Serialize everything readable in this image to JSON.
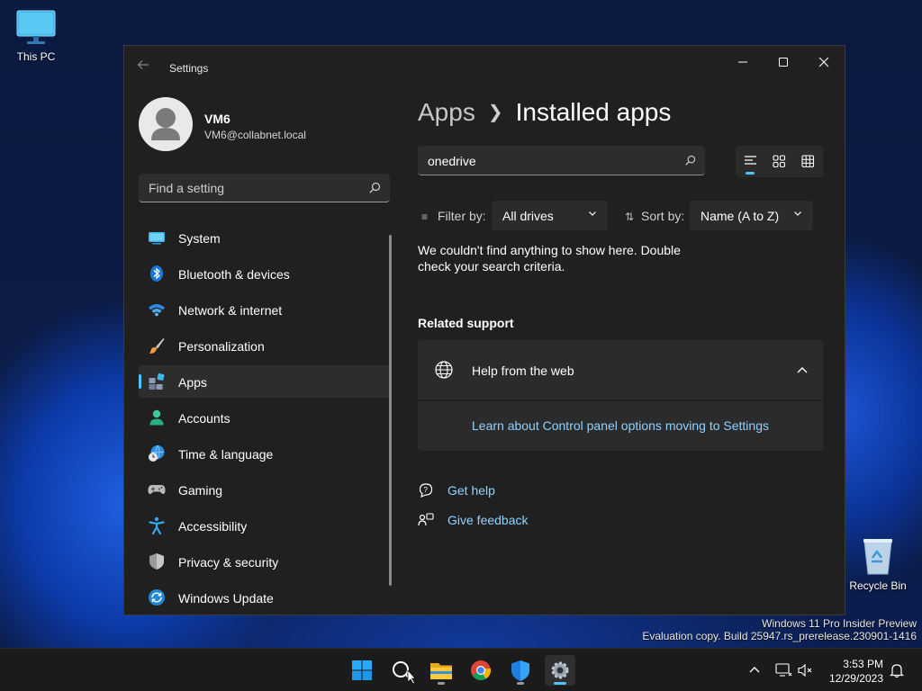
{
  "desktop": {
    "icons": [
      {
        "label": "This PC"
      },
      {
        "label": "Recycle Bin"
      }
    ],
    "watermark": {
      "line1": "Windows 11 Pro Insider Preview",
      "line2": "Evaluation copy. Build 25947.rs_prerelease.230901-1416"
    }
  },
  "window": {
    "title": "Settings",
    "back_icon": "back-arrow-icon",
    "controls": [
      "minimize",
      "maximize",
      "close"
    ]
  },
  "profile": {
    "name": "VM6",
    "email": "VM6@collabnet.local"
  },
  "find_setting": {
    "placeholder": "Find a setting"
  },
  "nav": {
    "items": [
      {
        "label": "System",
        "icon": "system-display-icon"
      },
      {
        "label": "Bluetooth & devices",
        "icon": "bluetooth-icon"
      },
      {
        "label": "Network & internet",
        "icon": "wifi-icon"
      },
      {
        "label": "Personalization",
        "icon": "paintbrush-icon"
      },
      {
        "label": "Apps",
        "icon": "apps-icon",
        "active": true
      },
      {
        "label": "Accounts",
        "icon": "person-icon"
      },
      {
        "label": "Time & language",
        "icon": "clock-globe-icon"
      },
      {
        "label": "Gaming",
        "icon": "gamepad-icon"
      },
      {
        "label": "Accessibility",
        "icon": "accessibility-icon"
      },
      {
        "label": "Privacy & security",
        "icon": "shield-icon"
      },
      {
        "label": "Windows Update",
        "icon": "update-icon"
      }
    ]
  },
  "main": {
    "breadcrumb": {
      "parent": "Apps",
      "current": "Installed apps"
    },
    "search": {
      "value": "onedrive"
    },
    "view_modes": [
      "list",
      "tiles",
      "grid"
    ],
    "filter": {
      "label": "Filter by:",
      "value": "All drives"
    },
    "sort": {
      "label": "Sort by:",
      "value": "Name (A to Z)"
    },
    "empty_message": "We couldn't find anything to show here. Double check your search criteria.",
    "related_support": {
      "title": "Related support",
      "card_label": "Help from the web",
      "link": "Learn about Control panel options moving to Settings"
    },
    "get_help": "Get help",
    "give_feedback": "Give feedback"
  },
  "taskbar": {
    "apps": [
      "start",
      "search",
      "file-explorer",
      "chrome",
      "defender",
      "settings"
    ],
    "clock": {
      "time": "3:53 PM",
      "date": "12/29/2023"
    }
  },
  "colors": {
    "accent": "#4cc2ff",
    "window_bg": "#202020",
    "card_bg": "#2b2b2b",
    "link": "#8fd2ff"
  }
}
